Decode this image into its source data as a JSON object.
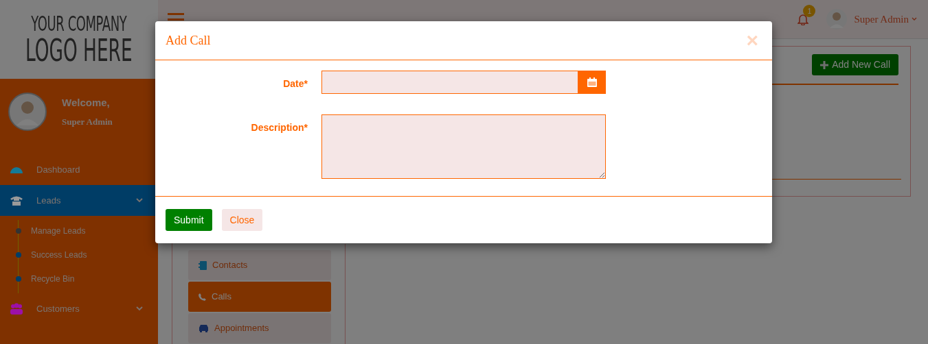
{
  "logo": {
    "line1": "YOUR COMPANY",
    "line2": "LOGO HERE"
  },
  "user_panel": {
    "greeting": "Welcome,",
    "name": "Super Admin"
  },
  "sidebar": {
    "items": [
      {
        "label": "Dashboard",
        "kind": "link",
        "selected": false,
        "color": "#137a98"
      },
      {
        "label": "Leads",
        "kind": "menu",
        "selected": true,
        "color": "#9a9a9a",
        "expanded": true,
        "children": [
          {
            "label": "Manage Leads",
            "selected": true
          },
          {
            "label": "Success Leads",
            "selected": false
          },
          {
            "label": "Recycle Bin",
            "selected": false
          }
        ]
      },
      {
        "label": "Customers",
        "kind": "menu",
        "selected": false,
        "color": "#9c10a8",
        "expanded": false
      }
    ]
  },
  "topbar": {
    "notifications": "1",
    "user": "Super Admin"
  },
  "tabs": [
    {
      "label": "Contacts",
      "selected": false
    },
    {
      "label": "Calls",
      "selected": true
    },
    {
      "label": "Appointments",
      "selected": false
    }
  ],
  "panel": {
    "add_button": "Add New Call"
  },
  "modal": {
    "title": "Add Call",
    "close": "×",
    "fields": [
      {
        "label": "Date*",
        "kind": "date"
      },
      {
        "label": "Description*",
        "kind": "textarea"
      }
    ],
    "buttons": [
      {
        "label": "Submit",
        "kind": "primary"
      },
      {
        "label": "Close",
        "kind": "secondary"
      }
    ]
  }
}
